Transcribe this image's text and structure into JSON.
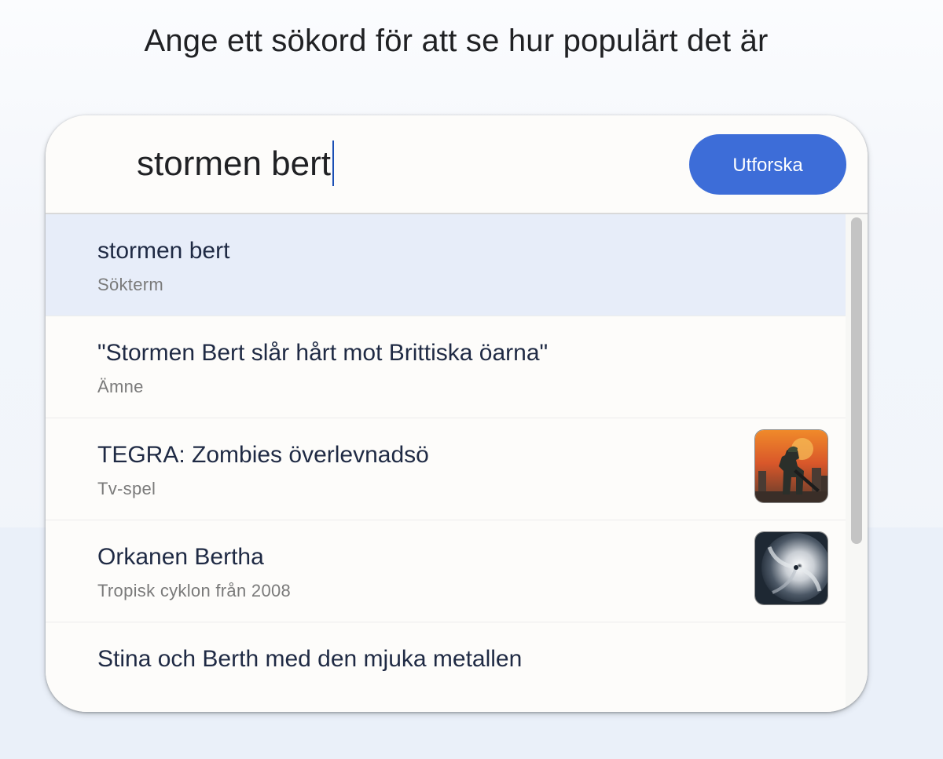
{
  "page": {
    "title": "Ange ett sökord för att se hur populärt det är"
  },
  "search": {
    "value": "stormen bert",
    "button_label": "Utforska"
  },
  "suggestions": [
    {
      "title": "stormen bert",
      "subtitle": "Sökterm",
      "selected": true,
      "thumbnail": null
    },
    {
      "title": "\"Stormen Bert slår hårt mot Brittiska öarna\"",
      "subtitle": "Ämne",
      "selected": false,
      "thumbnail": null
    },
    {
      "title": "TEGRA: Zombies överlevnadsö",
      "subtitle": "Tv-spel",
      "selected": false,
      "thumbnail": "game-cover-thumbnail"
    },
    {
      "title": "Orkanen Bertha",
      "subtitle": "Tropisk cyklon från 2008",
      "selected": false,
      "thumbnail": "hurricane-satellite-thumbnail"
    },
    {
      "title": "Stina och Berth med den mjuka metallen",
      "subtitle": "",
      "selected": false,
      "thumbnail": null
    }
  ],
  "colors": {
    "accent": "#3d6dd8",
    "selected_row": "#e7edf9",
    "caret": "#1a4fb5"
  }
}
